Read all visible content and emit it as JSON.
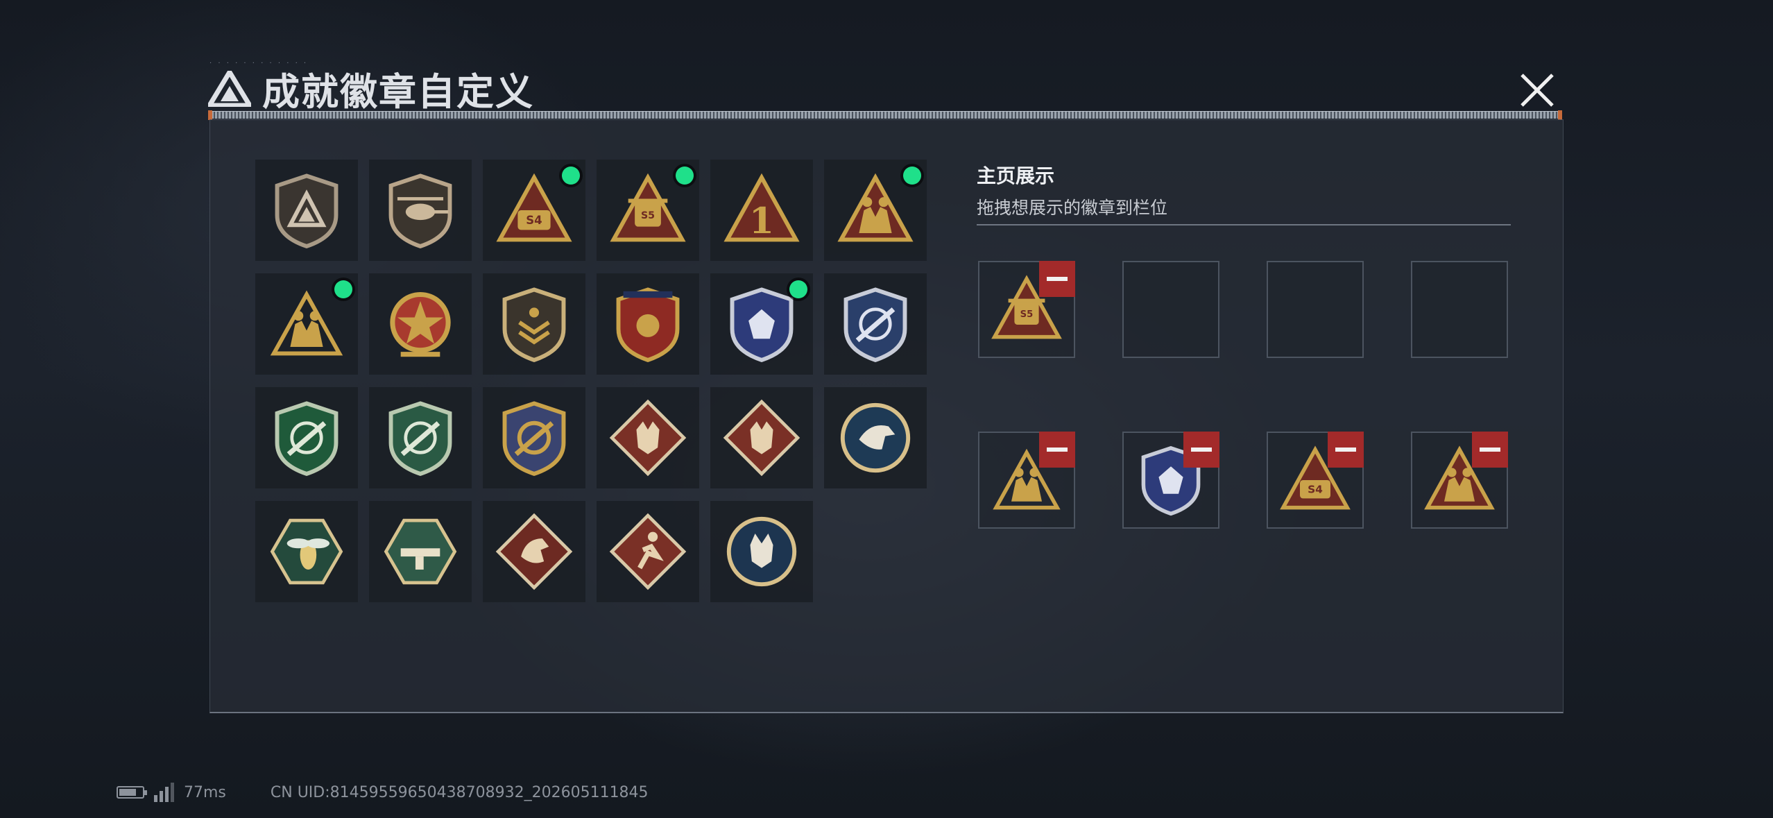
{
  "header": {
    "title": "成就徽章自定义",
    "close_icon": "close-icon"
  },
  "badges": [
    {
      "icon": "triangle-shield-badge",
      "new": false
    },
    {
      "icon": "helicopter-badge",
      "new": false
    },
    {
      "icon": "s4-triangle-badge",
      "new": true
    },
    {
      "icon": "s5-triangle-badge",
      "new": true
    },
    {
      "icon": "number-one-triangle-badge",
      "new": false
    },
    {
      "icon": "soldiers-triangle-badge",
      "new": true
    },
    {
      "icon": "soldiers-gold-badge",
      "new": true
    },
    {
      "icon": "star-medal-badge",
      "new": false
    },
    {
      "icon": "chevron-shield-badge",
      "new": false
    },
    {
      "icon": "red-crest-badge",
      "new": false
    },
    {
      "icon": "blue-diamond-shield-badge",
      "new": true
    },
    {
      "icon": "blue-crosshair-shield-badge",
      "new": false
    },
    {
      "icon": "green-crosshair-shield-badge",
      "new": false
    },
    {
      "icon": "green-crosshair-shield-badge-2",
      "new": false
    },
    {
      "icon": "gold-crosshair-shield-badge",
      "new": false
    },
    {
      "icon": "wolf-diamond-badge",
      "new": false
    },
    {
      "icon": "wolf-diamond-badge-2",
      "new": false
    },
    {
      "icon": "eagle-round-badge",
      "new": false
    },
    {
      "icon": "hornet-hexagon-badge",
      "new": false
    },
    {
      "icon": "weapon-hexagon-badge",
      "new": false
    },
    {
      "icon": "dragon-diamond-badge",
      "new": false
    },
    {
      "icon": "runner-diamond-badge",
      "new": false
    },
    {
      "icon": "lynx-round-badge",
      "new": false
    }
  ],
  "showcase": {
    "title": "主页展示",
    "subtitle": "拖拽想展示的徽章到栏位",
    "slots": [
      {
        "badge": "s5-triangle-badge",
        "filled": true
      },
      {
        "badge": "",
        "filled": false
      },
      {
        "badge": "",
        "filled": false
      },
      {
        "badge": "",
        "filled": false
      },
      {
        "badge": "soldiers-gold-badge",
        "filled": true
      },
      {
        "badge": "blue-diamond-shield-badge",
        "filled": true
      },
      {
        "badge": "s4-triangle-badge",
        "filled": true
      },
      {
        "badge": "soldiers-triangle-badge",
        "filled": true
      }
    ]
  },
  "status_bar": {
    "ping": "77ms",
    "uid": "CN UID:8145955965043870893​2_202605111845"
  },
  "colors": {
    "new_dot": "#1fe08a",
    "remove_button": "#a32a2a",
    "gold": "#c9a24a",
    "maroon": "#6e2a22"
  }
}
